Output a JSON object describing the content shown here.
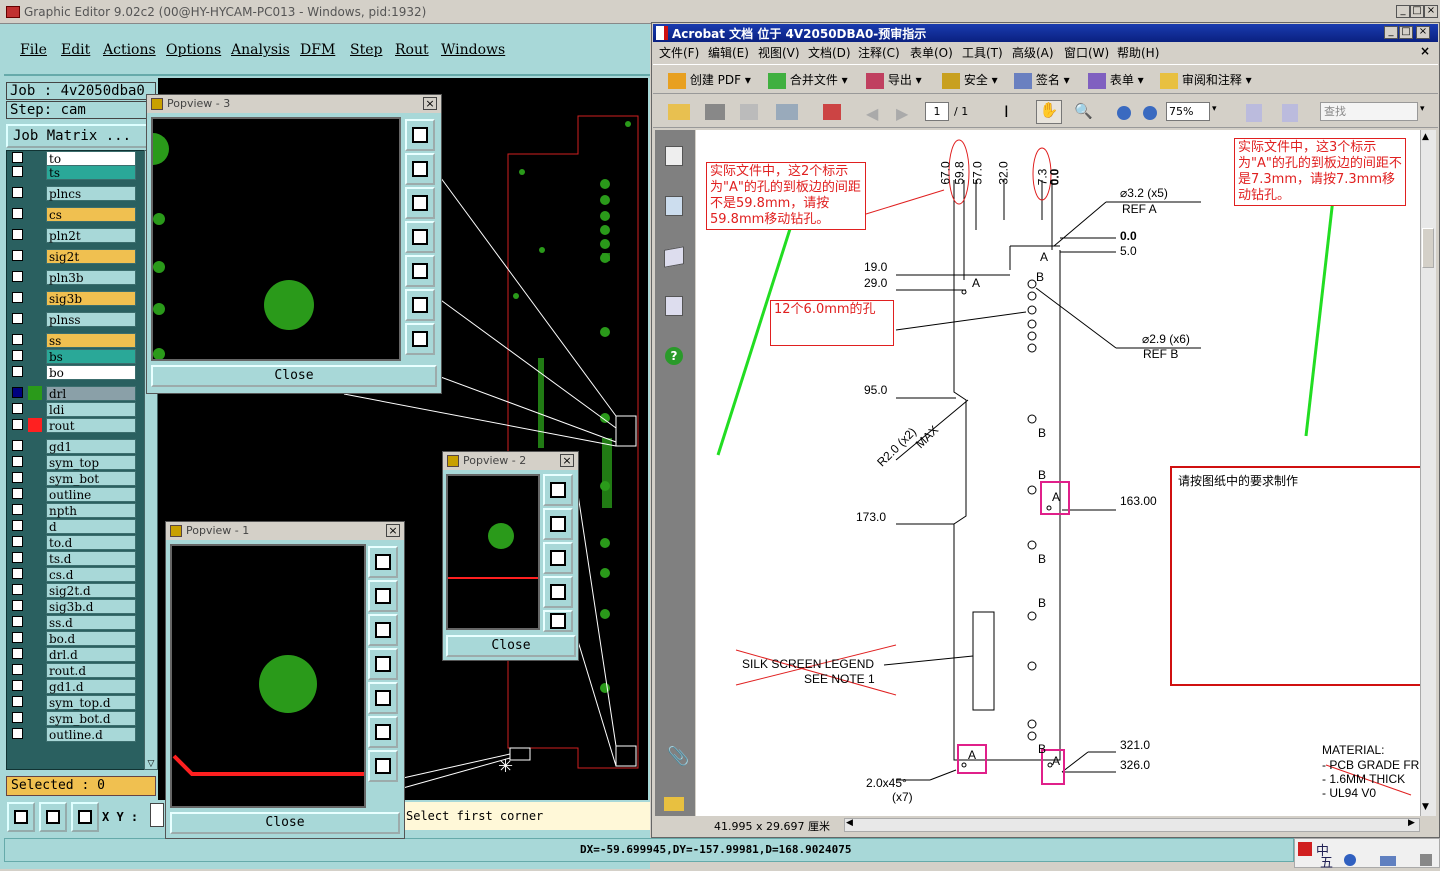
{
  "ge": {
    "title": "Graphic Editor 9.02c2 (00@HY-HYCAM-PC013 - Windows, pid:1932)",
    "menu": [
      "File",
      "Edit",
      "Actions",
      "Options",
      "Analysis",
      "DFM",
      "Step",
      "Rout",
      "Windows"
    ],
    "job": "Job : 4v2050dba0",
    "step": "Step: cam",
    "job_matrix": "Job Matrix ...",
    "layers": [
      "to",
      "ts",
      "plncs",
      "cs",
      "pln2t",
      "sig2t",
      "pln3b",
      "sig3b",
      "plnss",
      "ss",
      "bs",
      "bo",
      "drl",
      "ldi",
      "rout",
      "gd1",
      "sym_top",
      "sym_bot",
      "outline",
      "npth",
      "d",
      "to.d",
      "ts.d",
      "cs.d",
      "sig2t.d",
      "sig3b.d",
      "ss.d",
      "bo.d",
      "drl.d",
      "rout.d",
      "gd1.d",
      "sym_top.d",
      "sym_bot.d",
      "outline.d"
    ],
    "selected": "Selected : 0",
    "xy_label": "X Y :",
    "status_prompt": "Select first corner",
    "status_coords": "DX=-59.699945,DY=-157.99981,D=168.9024075",
    "popviews": [
      {
        "title": "Popview - 3",
        "close": "Close"
      },
      {
        "title": "Popview - 2",
        "close": "Close"
      },
      {
        "title": "Popview - 1",
        "close": "Close"
      }
    ]
  },
  "acro": {
    "title": "Acrobat 文档 位于 4V2050DBA0-预审指示",
    "menu": [
      "文件(F)",
      "编辑(E)",
      "视图(V)",
      "文档(D)",
      "注释(C)",
      "表单(O)",
      "工具(T)",
      "高级(A)",
      "窗口(W)",
      "帮助(H)"
    ],
    "toolbar": [
      "创建 PDF",
      "合并文件",
      "导出",
      "安全",
      "签名",
      "表单",
      "审阅和注释"
    ],
    "page_current": "1",
    "page_total": "/ 1",
    "zoom": "75%",
    "search_placeholder": "查找",
    "page_size": "41.995 x 29.697 厘米",
    "notes": {
      "n1": "实际文件中，这2个标示为\"A\"的孔的到板边的间距不是59.8mm，请按59.8mm移动钻孔。",
      "n2": "实际文件中，这3个标示为\"A\"的孔的到板边的间距不是7.3mm，请按7.3mm移动钻孔。",
      "n3": "12个6.0mm的孔",
      "n4": "请按图纸中的要求制作"
    },
    "drawing": {
      "top_dims": [
        "67.0",
        "59.8",
        "57.0",
        "32.0",
        "7.3",
        "0.0"
      ],
      "left_dims": [
        "19.0",
        "29.0",
        "95.0",
        "173.0"
      ],
      "right_dims": [
        "0.0",
        "5.0",
        "163.00",
        "321.0",
        "326.0"
      ],
      "hole_a": "⌀3.2  (x5)",
      "ref_a": "REF A",
      "hole_b": "⌀2.9  (x6)",
      "ref_b": "REF B",
      "radius": "R2.0 (x2)",
      "max": "MAX",
      "silk": "SILK SCREEN LEGEND",
      "see_note": "SEE NOTE 1",
      "chamfer": "2.0x45°",
      "chamfer_n": "(x7)",
      "material": [
        "MATERIAL:",
        "- PCB GRADE FR",
        "- 1.6MM THICK",
        "- UL94 V0"
      ]
    }
  },
  "colors": {
    "cyan": "#a8d8d8",
    "board": "#000000",
    "pad": "#3a9a1a",
    "red": "#ff2020",
    "note_red": "#e02020",
    "arrow": "#22dd22"
  }
}
